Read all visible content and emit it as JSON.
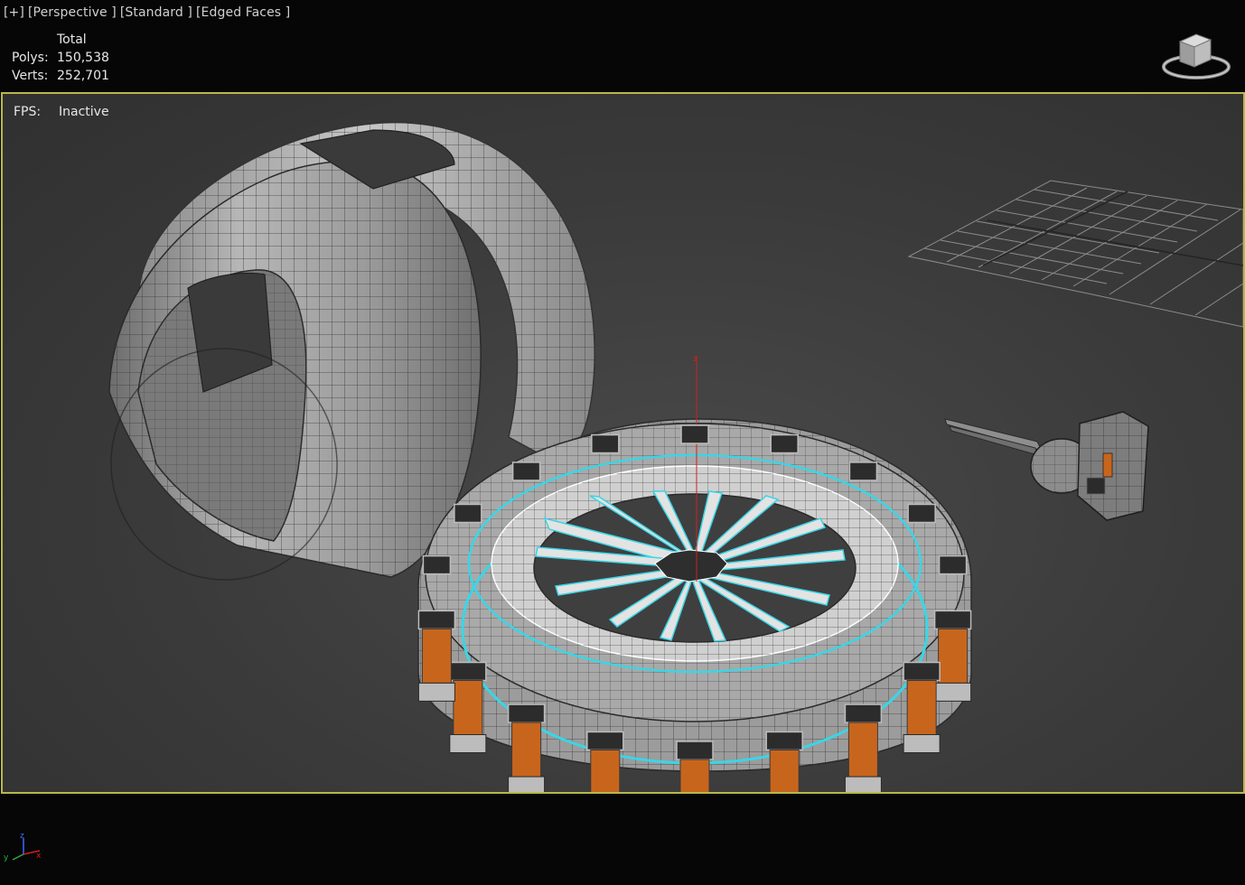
{
  "viewport_menu": {
    "plus": "[+]",
    "view": "[Perspective ]",
    "shading": "[Standard ]",
    "display": "[Edged Faces ]"
  },
  "stats": {
    "header": "Total",
    "polys_label": "Polys:",
    "polys_value": "150,538",
    "verts_label": "Verts:",
    "verts_value": "252,701",
    "fps_label": "FPS:",
    "fps_value": "Inactive"
  },
  "gizmo": {
    "z_label": "z",
    "axis_x": "x",
    "axis_y": "y",
    "axis_z": "z"
  },
  "colors": {
    "viewport_border": "#b9b84b",
    "selection_highlight": "#39d6e6",
    "mesh_gray": "#9a9a9a",
    "wire": "#2a2a2a",
    "orange_panel": "#c8651d"
  }
}
